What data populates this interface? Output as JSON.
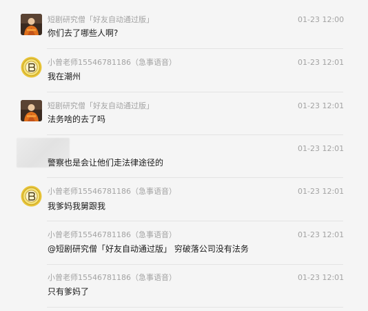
{
  "messages": [
    {
      "sender": "短剧研究僧「好友自动通过版」",
      "time": "01-23 12:00",
      "text": "你们去了哪些人啊?",
      "avatar": "monk-avatar-icon"
    },
    {
      "sender": "小曾老师15546781186（急事语音）",
      "time": "01-23 12:01",
      "text": "我在潮州",
      "avatar": "badge-avatar-icon"
    },
    {
      "sender": "短剧研究僧「好友自动通过版」",
      "time": "01-23 12:01",
      "text": "法务啥的去了吗",
      "avatar": "monk-avatar-icon"
    },
    {
      "sender": "",
      "time": "01-23 12:01",
      "text": "警察也是会让他们走法律途径的",
      "avatar": "blurred-avatar"
    },
    {
      "sender": "小曾老师15546781186（急事语音）",
      "time": "01-23 12:01",
      "text": "我爹妈我舅跟我",
      "avatar": "badge-avatar-icon"
    },
    {
      "sender": "小曾老师15546781186（急事语音）",
      "time": "01-23 12:01",
      "text": "@短剧研究僧「好友自动通过版」 穷破落公司没有法务",
      "avatar": ""
    },
    {
      "sender": "小曾老师15546781186（急事语音）",
      "time": "01-23 12:01",
      "text": "只有爹妈了",
      "avatar": ""
    }
  ],
  "colors": {
    "background": "#f5f5f5",
    "meta_text": "#a3a3a3",
    "message_text": "#1a1a1a",
    "separator": "#e3e3e3",
    "badge_yellow": "#e8c53a"
  }
}
